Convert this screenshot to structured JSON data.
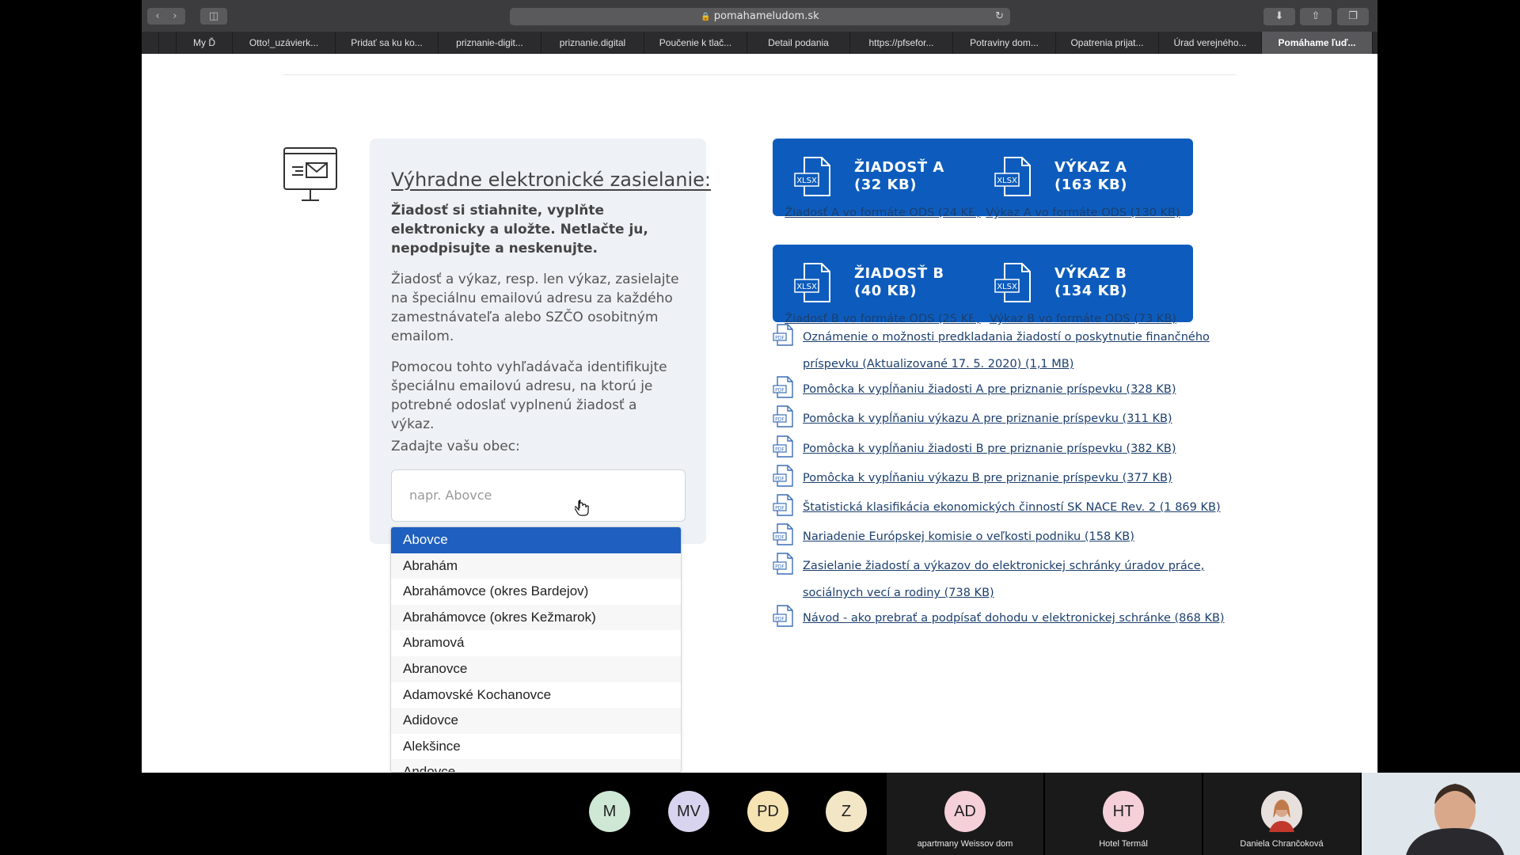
{
  "browser": {
    "url": "pomahameludom.sk",
    "tabs": [
      {
        "label": "My Ď"
      },
      {
        "label": "Otto!_uzávierk..."
      },
      {
        "label": "Pridať sa ku ko..."
      },
      {
        "label": "priznanie-digit..."
      },
      {
        "label": "priznanie.digital"
      },
      {
        "label": "Poučenie k tlač..."
      },
      {
        "label": "Detail podania"
      },
      {
        "label": "https://pfsefor..."
      },
      {
        "label": "Potraviny dom..."
      },
      {
        "label": "Opatrenia prijat..."
      },
      {
        "label": "Úrad verejného..."
      },
      {
        "label": "Pomáhame ľuď..."
      }
    ],
    "new_tab": "+"
  },
  "panel": {
    "title": "Výhradne elektronické zasielanie:",
    "bold_text": "Žiadosť si stiahnite, vyplňte elektronicky a uložte. Netlačte ju, nepodpisujte a neskenujte.",
    "para1": "Žiadosť a výkaz, resp. len výkaz, zasielajte na špeciálnu emailovú adresu za každého zamestnávateľa alebo SZČO osobitným emailom.",
    "para2": "Pomocou tohto vyhľadávača identifikujte špeciálnu emailovú adresu, na ktorú je potrebné odoslať vyplnenú žiadosť a výkaz.",
    "label": "Zadajte vašu obec:",
    "search_placeholder": "napr. Abovce"
  },
  "dropdown": {
    "items": [
      "Abovce",
      "Abrahám",
      "Abrahámovce (okres Bardejov)",
      "Abrahámovce (okres Kežmarok)",
      "Abramová",
      "Abranovce",
      "Adamovské Kochanovce",
      "Adidovce",
      "Alekšince",
      "Andovce"
    ],
    "selected_index": 0
  },
  "downloads": [
    {
      "line1": "ŽIADOSŤ A",
      "line2": "(32 KB)",
      "ods": "Žiadosť A vo formáte ODS (24 KB)"
    },
    {
      "line1": "VÝKAZ A",
      "line2": "(163 KB)",
      "ods": "Výkaz A vo formáte ODS (130 KB)"
    },
    {
      "line1": "ŽIADOSŤ B",
      "line2": "(40 KB)",
      "ods": "Žiadosť B vo formáte ODS (25 KB)"
    },
    {
      "line1": "VÝKAZ B",
      "line2": "(134 KB)",
      "ods": "Výkaz B vo formáte ODS (73 KB)"
    }
  ],
  "xlsx_badge": "XLSX",
  "pdf_badge": "PDF",
  "pdf_links": [
    "Oznámenie o možnosti predkladania žiadostí o poskytnutie finančného príspevku (Aktualizované 17. 5. 2020) (1,1 MB)",
    "Pomôcka k vypĺňaniu žiadosti A pre priznanie príspevku (328 KB)",
    "Pomôcka k vypĺňaniu výkazu A pre priznanie príspevku (311 KB)",
    "Pomôcka k vypĺňaniu žiadosti B pre priznanie príspevku (382 KB)",
    "Pomôcka k vypĺňaniu výkazu B pre priznanie príspevku (377 KB)",
    "Štatistická klasifikácia ekonomických činností SK NACE Rev. 2 (1 869 KB)",
    "Nariadenie Európskej komisie o veľkosti podniku (158 KB)",
    "Zasielanie žiadostí a výkazov do elektronickej schránky úradov práce, sociálnych vecí a rodiny (738 KB)",
    "Návod - ako prebrať a podpísať dohodu v elektronickej schránke (868 KB)"
  ],
  "call": {
    "participants": [
      {
        "initials": "M",
        "color": "#cfe8d6"
      },
      {
        "initials": "MV",
        "color": "#d8d3ee"
      },
      {
        "initials": "PD",
        "color": "#f6e3b4"
      },
      {
        "initials": "Z",
        "color": "#f3e6c7"
      }
    ],
    "tiles": [
      {
        "initials": "AD",
        "name": "apartmany Weissov dom",
        "color": "#f5d0d8"
      },
      {
        "initials": "HT",
        "name": "Hotel Termál",
        "color": "#f5d0d8"
      },
      {
        "initials": "",
        "name": "Daniela Chrančoková",
        "color": "#e8c9b8"
      }
    ]
  }
}
